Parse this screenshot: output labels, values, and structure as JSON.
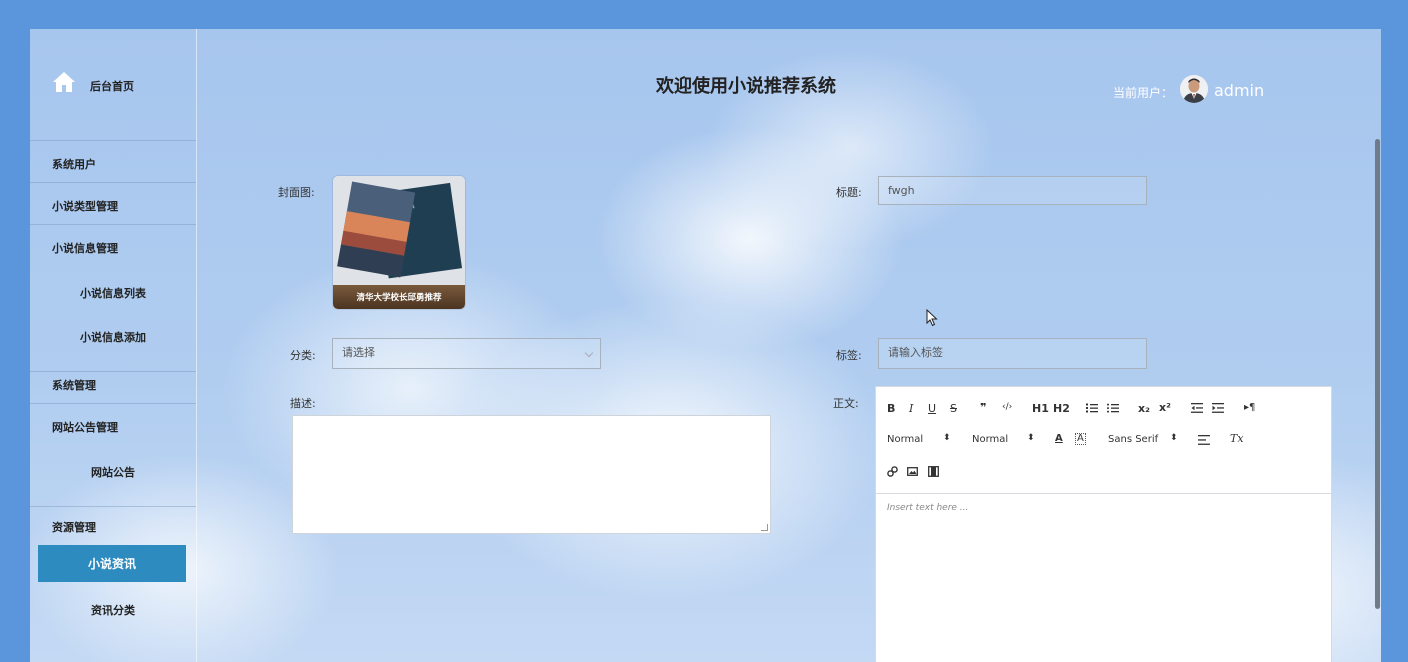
{
  "sidebar": {
    "home": "后台首页",
    "items": [
      {
        "label": "系统用户"
      },
      {
        "label": "小说类型管理"
      },
      {
        "label": "小说信息管理"
      },
      {
        "label": "小说信息列表"
      },
      {
        "label": "小说信息添加"
      },
      {
        "label": "系统管理"
      },
      {
        "label": "网站公告管理"
      },
      {
        "label": "网站公告"
      },
      {
        "label": "资源管理"
      },
      {
        "label": "小说资讯"
      },
      {
        "label": "资讯分类"
      }
    ]
  },
  "header": {
    "title": "欢迎使用小说推荐系统",
    "user_label": "当前用户：",
    "user_name": "admin"
  },
  "form": {
    "cover_label": "封面图:",
    "cover_caption": "清华大学校长邱勇推荐",
    "title_label": "标题:",
    "title_value": "fwgh",
    "category_label": "分类:",
    "category_value": "请选择",
    "tag_label": "标签:",
    "tag_placeholder": "请输入标签",
    "desc_label": "描述:",
    "body_label": "正文:"
  },
  "editor": {
    "bold": "B",
    "italic": "I",
    "underline": "U",
    "strike": "S",
    "quote": "❞",
    "code": "‹/›",
    "h1": "H1",
    "h2": "H2",
    "sub": "x₂",
    "sup": "x²",
    "rtl": "▸¶",
    "size1": "Normal",
    "size2": "Normal",
    "font": "Sans Serif",
    "clear": "Tx",
    "placeholder": "Insert text here ..."
  },
  "colors": {
    "active_menu": "#2e8bc0",
    "page_bg": "#5b95dc"
  }
}
